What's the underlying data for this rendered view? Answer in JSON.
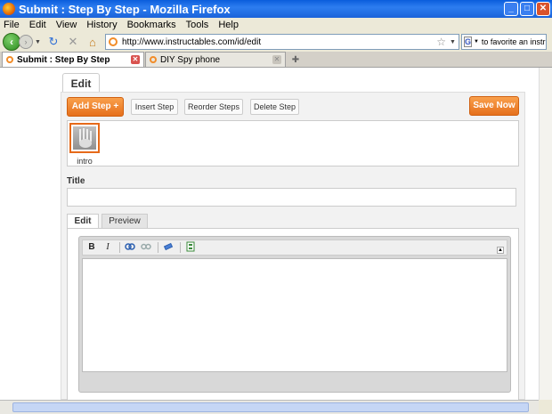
{
  "window": {
    "title": "Submit : Step By Step - Mozilla Firefox",
    "controls": [
      "_",
      "□",
      "✕"
    ]
  },
  "menu": [
    "File",
    "Edit",
    "View",
    "History",
    "Bookmarks",
    "Tools",
    "Help"
  ],
  "nav": {
    "url": "http://www.instructables.com/id/edit",
    "search_text": "to favorite an instru"
  },
  "tabs": [
    {
      "label": "Submit : Step By Step",
      "active": true
    },
    {
      "label": "DIY Spy phone",
      "active": false
    }
  ],
  "page": {
    "edit_tab": "Edit",
    "add_step": "Add Step +",
    "insert_step": "Insert Step",
    "reorder_steps": "Reorder Steps",
    "delete_step": "Delete Step",
    "save_now": "Save Now",
    "step_thumb_label": "intro",
    "title_label": "Title",
    "title_value": "",
    "subtabs": [
      "Edit",
      "Preview"
    ],
    "toolbar": [
      "B",
      "I",
      "link",
      "unlink",
      "eraser",
      "image"
    ]
  },
  "colors": {
    "accent": "#e6701c",
    "titlebar": "#0a5ddc"
  }
}
